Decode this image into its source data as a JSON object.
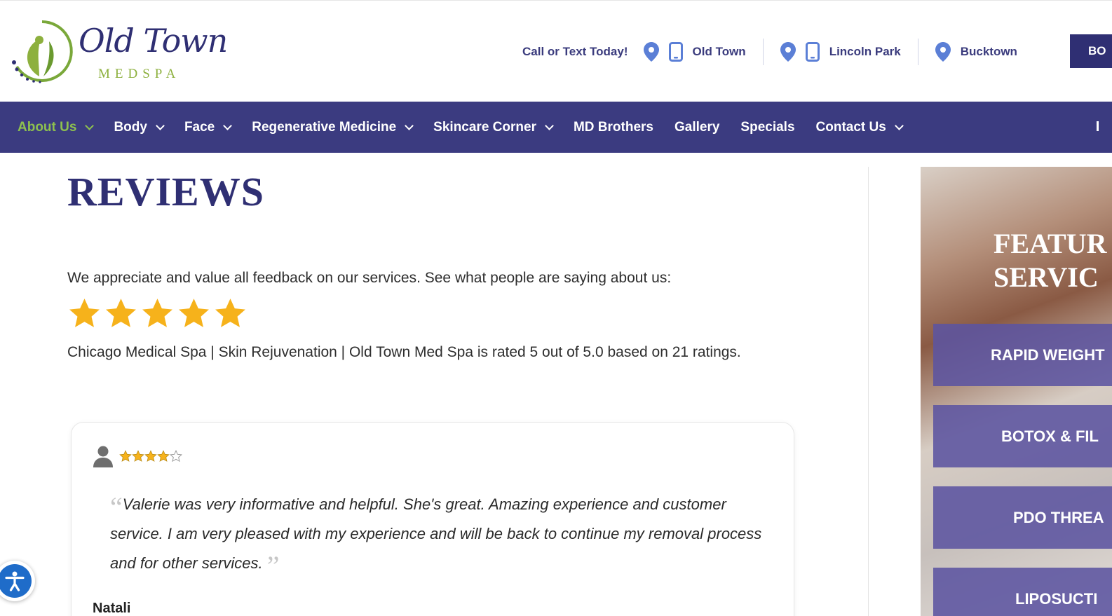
{
  "header": {
    "logo": {
      "script_text": "Old Town",
      "sub_text": "MEDSPA"
    },
    "call_text": "Call or Text Today!",
    "locations": [
      {
        "name": "Old Town"
      },
      {
        "name": "Lincoln Park"
      },
      {
        "name": "Bucktown"
      }
    ],
    "book_label": "BO"
  },
  "nav": {
    "items": [
      {
        "label": "About Us",
        "dropdown": true,
        "active": true
      },
      {
        "label": "Body",
        "dropdown": true
      },
      {
        "label": "Face",
        "dropdown": true
      },
      {
        "label": "Regenerative Medicine",
        "dropdown": true
      },
      {
        "label": "Skincare Corner",
        "dropdown": true
      },
      {
        "label": "MD Brothers",
        "dropdown": false
      },
      {
        "label": "Gallery",
        "dropdown": false
      },
      {
        "label": "Specials",
        "dropdown": false
      },
      {
        "label": "Contact Us",
        "dropdown": true
      }
    ]
  },
  "main": {
    "title": "REVIEWS",
    "intro": "We appreciate and value all feedback on our services. See what people are saying about us:",
    "overall_stars": 5,
    "rating_text": "Chicago Medical Spa | Skin Rejuvenation | Old Town Med Spa is rated 5 out of 5.0 based on 21 ratings."
  },
  "review": {
    "stars": 4,
    "max_stars": 5,
    "quote": "Valerie was very informative and helpful. She's great. Amazing experience and customer service. I am very pleased with my experience and will be back to continue my removal process and for other services.",
    "author": "Natali"
  },
  "sidebar": {
    "title_line1": "FEATUR",
    "title_line2": "SERVIC",
    "buttons": [
      {
        "label": "RAPID WEIGHT"
      },
      {
        "label": "BOTOX & FIL"
      },
      {
        "label": "PDO THREA"
      },
      {
        "label": "LIPOSUCTI"
      }
    ]
  },
  "colors": {
    "brand_navy": "#3b3b80",
    "accent_green": "#8dc04f",
    "star_gold": "#f6b21b",
    "icon_blue": "#5b7fd6"
  }
}
